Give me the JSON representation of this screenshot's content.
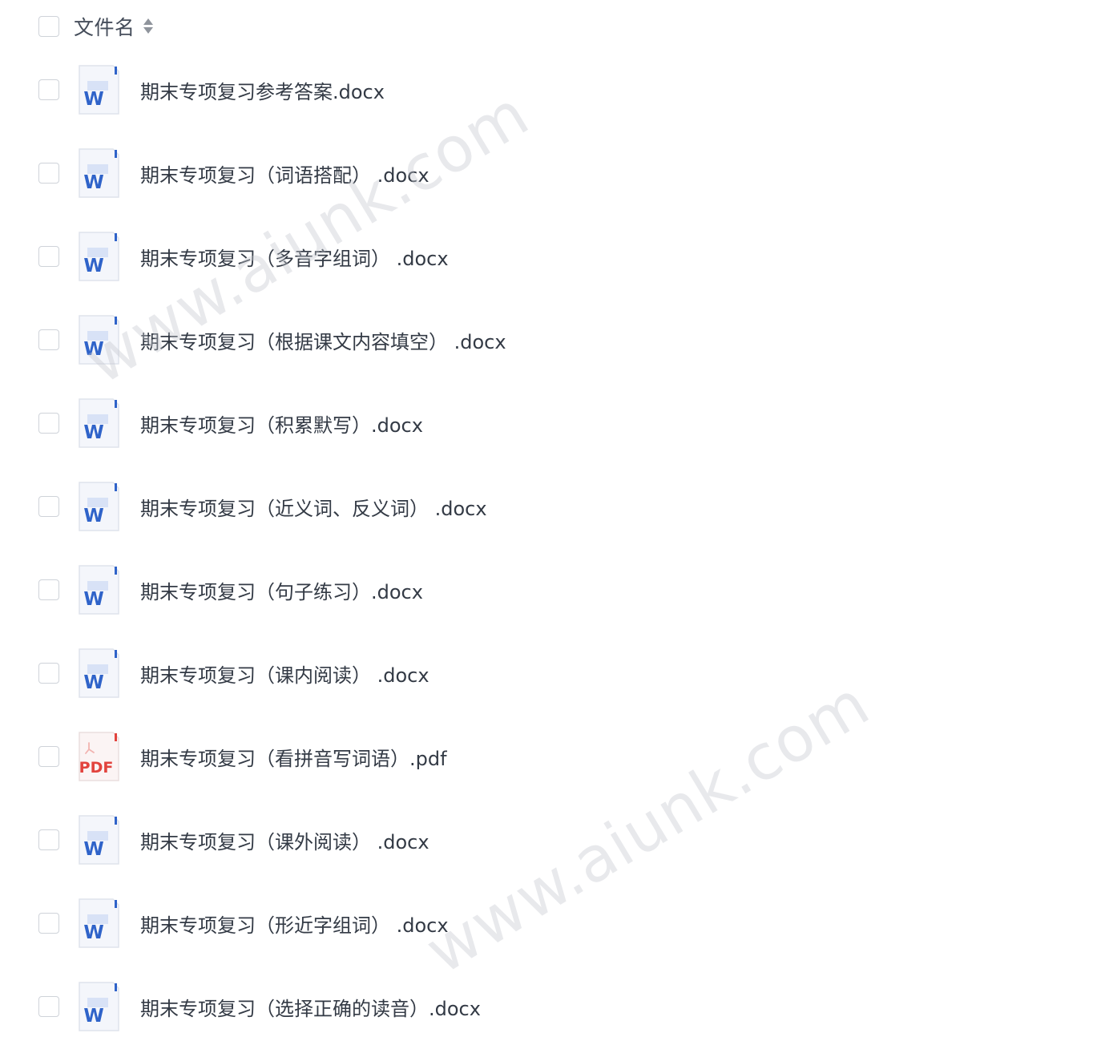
{
  "header": {
    "column_label": "文件名",
    "sort_icon": "sort-icon"
  },
  "files": [
    {
      "name": "期末专项复习参考答案.docx",
      "type": "docx",
      "icon": "word-file-icon"
    },
    {
      "name": "期末专项复习（词语搭配） .docx",
      "type": "docx",
      "icon": "word-file-icon"
    },
    {
      "name": "期末专项复习（多音字组词） .docx",
      "type": "docx",
      "icon": "word-file-icon"
    },
    {
      "name": "期末专项复习（根据课文内容填空） .docx",
      "type": "docx",
      "icon": "word-file-icon"
    },
    {
      "name": "期末专项复习（积累默写）.docx",
      "type": "docx",
      "icon": "word-file-icon"
    },
    {
      "name": "期末专项复习（近义词、反义词） .docx",
      "type": "docx",
      "icon": "word-file-icon"
    },
    {
      "name": "期末专项复习（句子练习）.docx",
      "type": "docx",
      "icon": "word-file-icon"
    },
    {
      "name": "期末专项复习（课内阅读） .docx",
      "type": "docx",
      "icon": "word-file-icon"
    },
    {
      "name": "期末专项复习（看拼音写词语）.pdf",
      "type": "pdf",
      "icon": "pdf-file-icon"
    },
    {
      "name": "期末专项复习（课外阅读） .docx",
      "type": "docx",
      "icon": "word-file-icon"
    },
    {
      "name": "期末专项复习（形近字组词） .docx",
      "type": "docx",
      "icon": "word-file-icon"
    },
    {
      "name": "期末专项复习（选择正确的读音）.docx",
      "type": "docx",
      "icon": "word-file-icon"
    }
  ],
  "icon_labels": {
    "word": "W",
    "pdf": "PDF"
  },
  "watermark": {
    "text_1": "www.aiunk.com",
    "text_2": "www.aiunk.com"
  },
  "colors": {
    "word_blue": "#2f63c9",
    "pdf_red": "#e2433d",
    "checkbox_border": "#cfd3d9",
    "text": "#333a45"
  }
}
